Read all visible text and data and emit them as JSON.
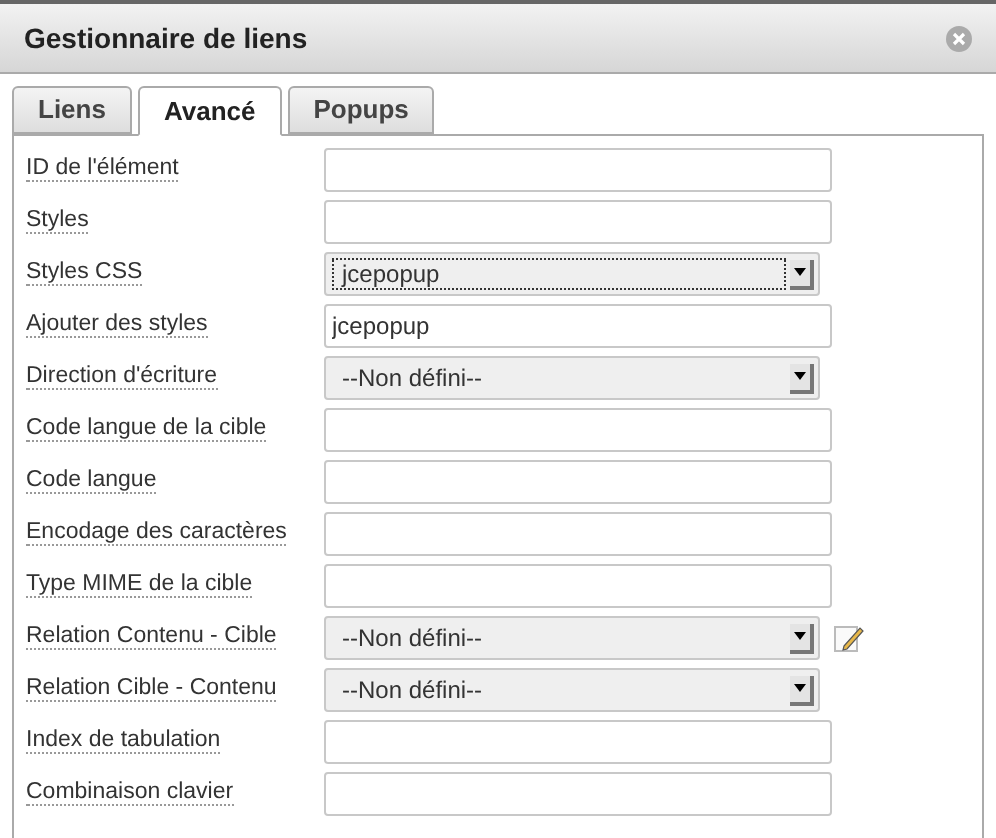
{
  "window": {
    "title": "Gestionnaire de liens"
  },
  "tabs": [
    {
      "label": "Liens",
      "selected": false
    },
    {
      "label": "Avancé",
      "selected": true
    },
    {
      "label": "Popups",
      "selected": false
    }
  ],
  "fields": [
    {
      "label": "ID de l'élément",
      "kind": "text"
    },
    {
      "label": "Styles",
      "kind": "text"
    },
    {
      "label": "Styles CSS",
      "kind": "select",
      "value": "jcepopup",
      "focused": true
    },
    {
      "label": "Ajouter des styles",
      "kind": "text",
      "value": "jcepopup"
    },
    {
      "label": "Direction d'écriture",
      "kind": "select",
      "value": "--Non défini--",
      "focused": false
    },
    {
      "label": "Code langue de la cible",
      "kind": "text"
    },
    {
      "label": "Code langue",
      "kind": "text"
    },
    {
      "label": "Encodage des caractères",
      "kind": "text"
    },
    {
      "label": "Type MIME de la cible",
      "kind": "text"
    },
    {
      "label": "Relation Contenu - Cible",
      "kind": "select",
      "value": "--Non défini--",
      "focused": false,
      "edit_icon": true
    },
    {
      "label": "Relation Cible - Contenu",
      "kind": "select",
      "value": "--Non défini--",
      "focused": false
    },
    {
      "label": "Index de tabulation",
      "kind": "text"
    },
    {
      "label": "Combinaison clavier",
      "kind": "text"
    }
  ]
}
